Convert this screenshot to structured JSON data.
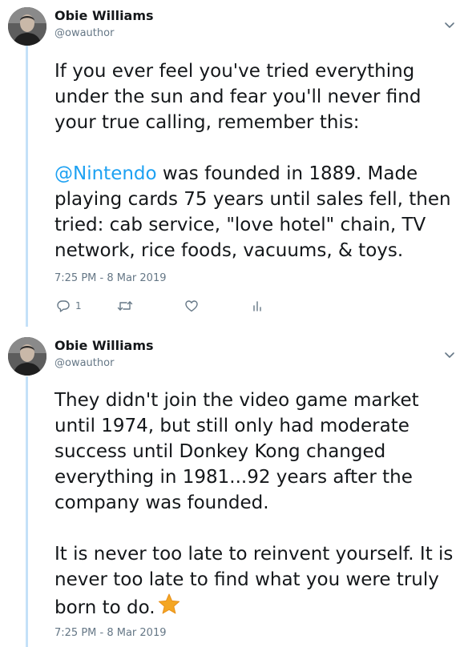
{
  "thread": [
    {
      "author_name": "Obie Williams",
      "author_handle": "@owauthor",
      "paragraph1": "If you ever feel you've tried everything under the sun and fear you'll never find your true calling, remember this:",
      "mention": "@Nintendo",
      "paragraph2_rest": " was founded in 1889. Made playing cards 75 years until sales fell, then tried: cab service, \"love hotel\" chain, TV network, rice foods, vacuums, & toys.",
      "timestamp": "7:25 PM - 8 Mar 2019",
      "reply_count": "1"
    },
    {
      "author_name": "Obie Williams",
      "author_handle": "@owauthor",
      "paragraph1": "They didn't join the video game market until 1974, but still only had moderate success until Donkey Kong changed everything in 1981...92 years after the company was founded.",
      "paragraph2": "It is never too late to reinvent yourself. It is never too late to find what you were truly born to do.",
      "timestamp": "7:25 PM - 8 Mar 2019"
    }
  ],
  "colors": {
    "link": "#1da1f2",
    "thread_line": "#c4e1f8",
    "secondary_text": "#657786",
    "star": "#f4a623"
  },
  "icons": [
    "chevron-down-icon",
    "reply-icon",
    "retweet-icon",
    "like-icon",
    "analytics-icon",
    "star-emoji-icon"
  ]
}
